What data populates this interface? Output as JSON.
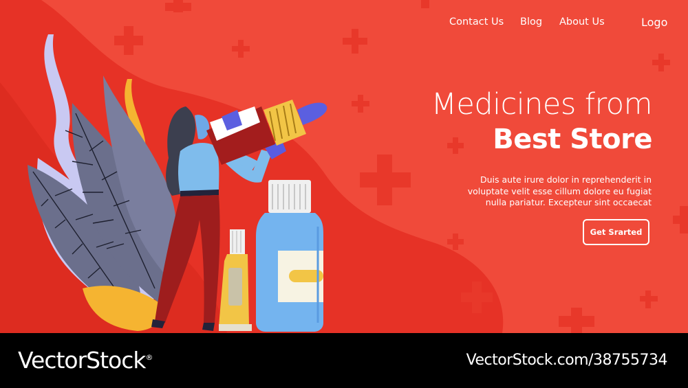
{
  "nav": {
    "items": [
      "Contact Us",
      "Blog",
      "About Us"
    ],
    "logo": "Logo"
  },
  "hero": {
    "title_line1": "Medicines from",
    "title_line2": "Best Store",
    "description_lines": [
      "Duis aute irure dolor in reprehenderit in",
      "voluptate velit esse cillum dolore eu fugiat",
      "nulla pariatur. Excepteur sint occaecat"
    ],
    "cta_label": "Get Srarted"
  },
  "watermark": {
    "brand": "VectorStock",
    "registered": "®",
    "image_id": "VectorStock.com/38755734"
  },
  "colors": {
    "background": "#f04a3a",
    "wave": "#e63226",
    "text": "#ffffff",
    "bottle": "#74b4ef",
    "tube": "#f2c546",
    "leaf": "#6b6f8c",
    "leaf_light": "#c9c9f2"
  },
  "icons": [
    "plus-icon",
    "person-figure",
    "dropper-bottle-icon",
    "medicine-bottle-icon",
    "ointment-tube-icon",
    "leaf-icon",
    "smoke-icon"
  ]
}
